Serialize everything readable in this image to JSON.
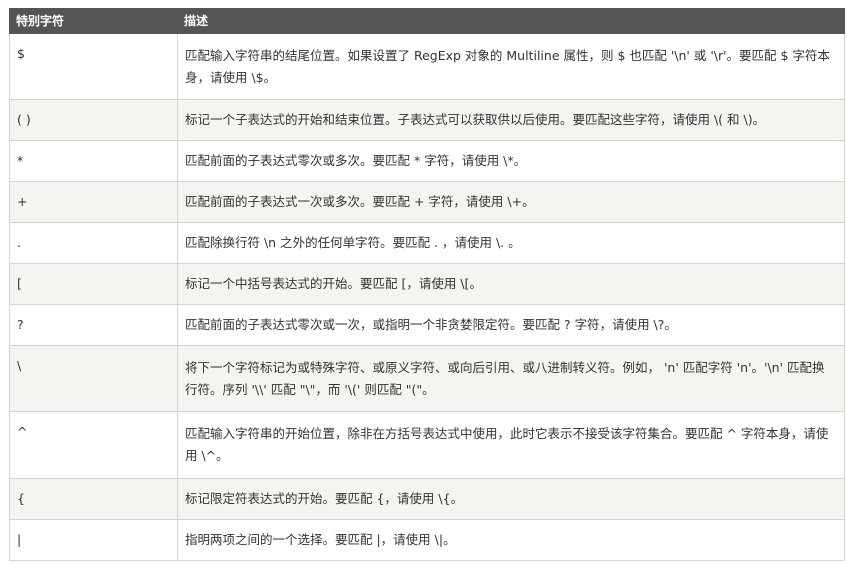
{
  "table": {
    "headers": [
      "特别字符",
      "描述"
    ],
    "rows": [
      {
        "char": "$",
        "desc": "匹配输入字符串的结尾位置。如果设置了 RegExp 对象的 Multiline 属性，则 $ 也匹配 '\\n' 或 '\\r'。要匹配 $ 字符本身，请使用 \\$。"
      },
      {
        "char": "( )",
        "desc": "标记一个子表达式的开始和结束位置。子表达式可以获取供以后使用。要匹配这些字符，请使用 \\( 和 \\)。"
      },
      {
        "char": "*",
        "desc": "匹配前面的子表达式零次或多次。要匹配 * 字符，请使用 \\*。"
      },
      {
        "char": "+",
        "desc": "匹配前面的子表达式一次或多次。要匹配 + 字符，请使用 \\+。"
      },
      {
        "char": ".",
        "desc": "匹配除换行符 \\n 之外的任何单字符。要匹配 . ，请使用 \\. 。"
      },
      {
        "char": "[",
        "desc": "标记一个中括号表达式的开始。要匹配 [，请使用 \\[。"
      },
      {
        "char": "?",
        "desc": "匹配前面的子表达式零次或一次，或指明一个非贪婪限定符。要匹配 ? 字符，请使用 \\?。"
      },
      {
        "char": "\\",
        "desc": "将下一个字符标记为或特殊字符、或原义字符、或向后引用、或八进制转义符。例如， 'n' 匹配字符 'n'。'\\n' 匹配换行符。序列 '\\\\' 匹配 \"\\\"，而 '\\(' 则匹配 \"(\"。"
      },
      {
        "char": "^",
        "desc": "匹配输入字符串的开始位置，除非在方括号表达式中使用，此时它表示不接受该字符集合。要匹配 ^ 字符本身，请使用 \\^。"
      },
      {
        "char": "{",
        "desc": "标记限定符表达式的开始。要匹配 {，请使用 \\{。"
      },
      {
        "char": "|",
        "desc": "指明两项之间的一个选择。要匹配 |，请使用 \\|。"
      }
    ]
  }
}
